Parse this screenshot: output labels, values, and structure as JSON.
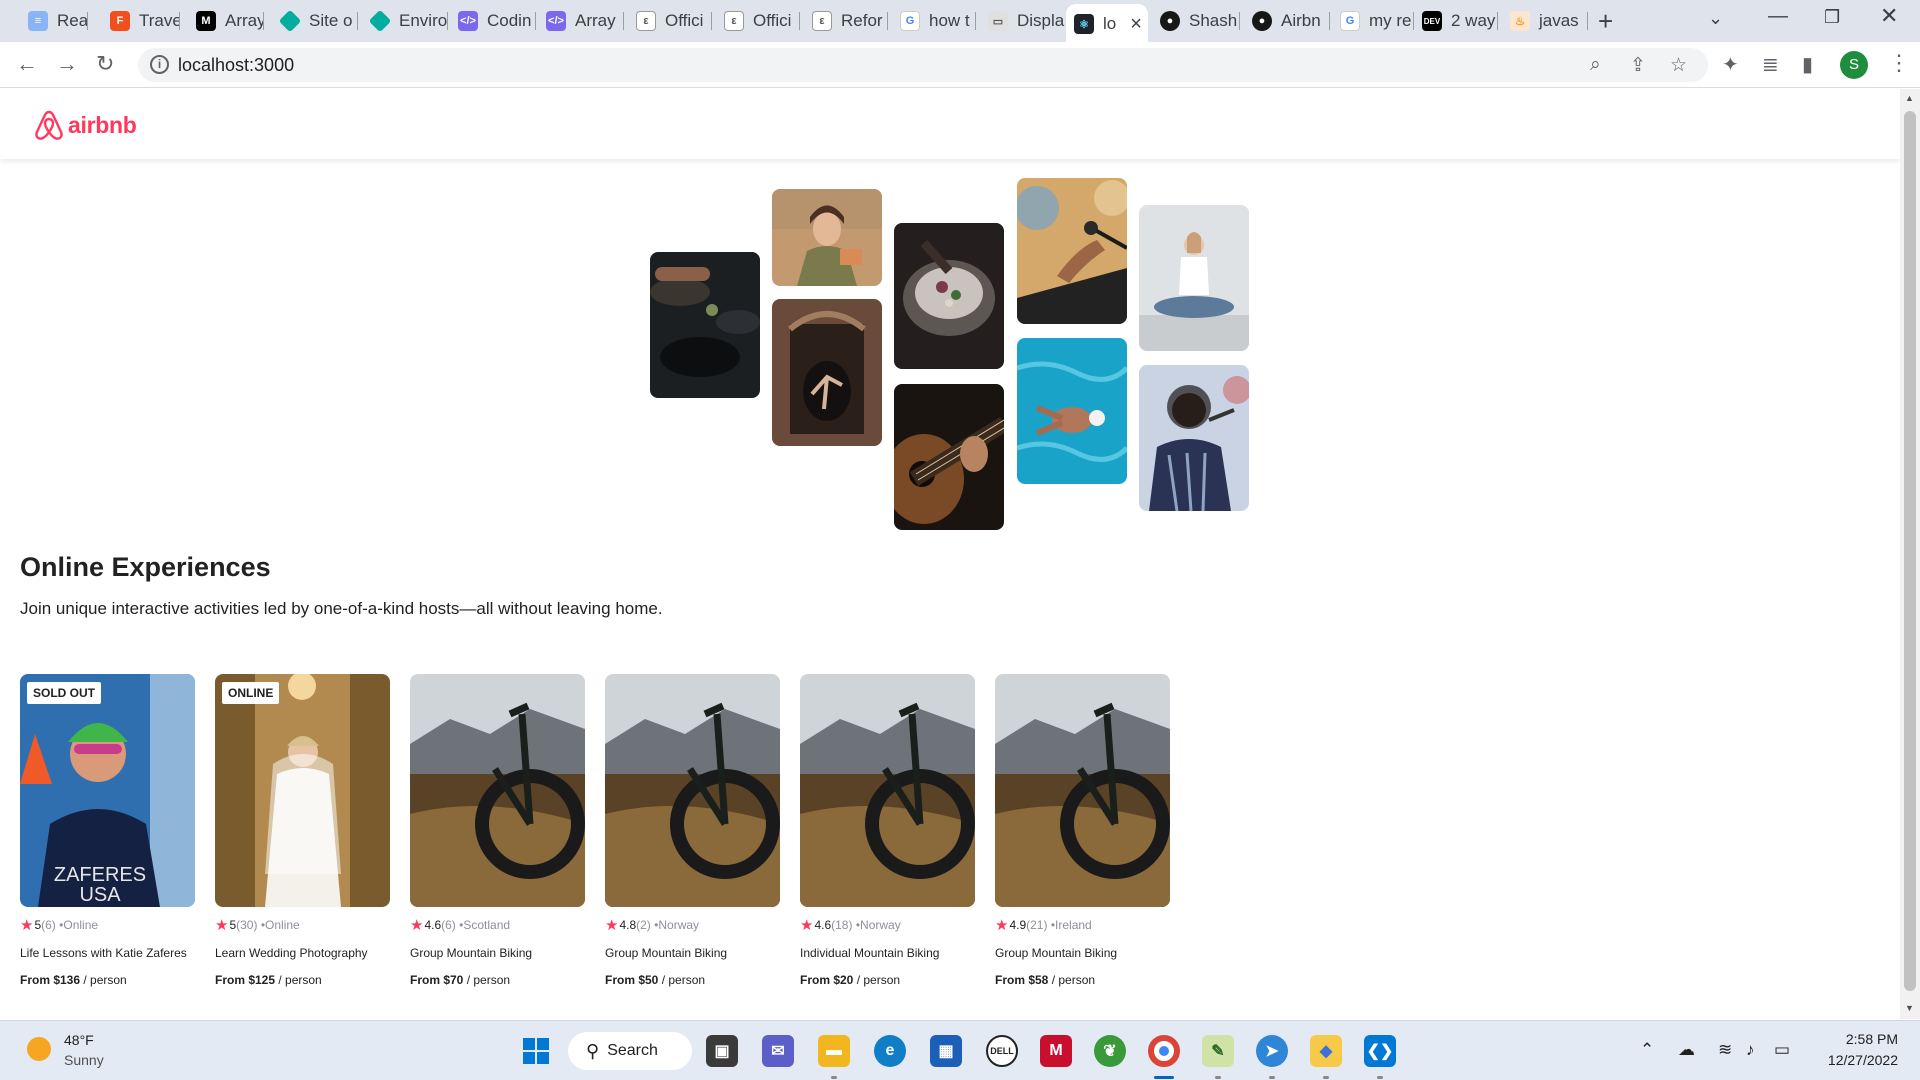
{
  "browser": {
    "tabs": [
      {
        "label": "React",
        "icon": "react-doc-icon",
        "color": "#8ab4f8"
      },
      {
        "label": "Travel",
        "icon": "figma-icon",
        "color": "#f24e1e"
      },
      {
        "label": "Array",
        "icon": "medium-icon",
        "color": "#000000"
      },
      {
        "label": "Site o",
        "icon": "netlify-icon",
        "color": "#00ad9f"
      },
      {
        "label": "Enviro",
        "icon": "netlify-icon",
        "color": "#00ad9f"
      },
      {
        "label": "Codin",
        "icon": "code-icon",
        "color": "#7b68ee"
      },
      {
        "label": "Array",
        "icon": "code-icon",
        "color": "#7b68ee"
      },
      {
        "label": "Offici",
        "icon": "scrimba-icon",
        "color": "#555555"
      },
      {
        "label": "Offici",
        "icon": "scrimba-icon",
        "color": "#555555"
      },
      {
        "label": "Refor",
        "icon": "scrimba-icon",
        "color": "#555555"
      },
      {
        "label": "how t",
        "icon": "google-icon",
        "color": "#4285f4"
      },
      {
        "label": "Displa",
        "icon": "display-icon",
        "color": "#777777"
      },
      {
        "label": "lo",
        "icon": "react-icon",
        "color": "#20232a"
      },
      {
        "label": "Shash",
        "icon": "github-icon",
        "color": "#181717"
      },
      {
        "label": "Airbn",
        "icon": "github-icon",
        "color": "#181717"
      },
      {
        "label": "my re",
        "icon": "google-icon",
        "color": "#4285f4"
      },
      {
        "label": "2 way",
        "icon": "dev-icon",
        "color": "#000000"
      },
      {
        "label": "javas",
        "icon": "java-icon",
        "color": "#f89820"
      }
    ],
    "url": "localhost:3000",
    "profile_initial": "S"
  },
  "page": {
    "brand": "airbnb",
    "brand_color": "#ff385c",
    "hero": {
      "title": "Online Experiences",
      "subtitle": "Join unique interactive activities led by one-of-a-kind hosts—all without leaving home."
    },
    "cards": [
      {
        "badge": "SOLD OUT",
        "rating": "5",
        "reviews": "(6)",
        "location": "Online",
        "title": "Life Lessons with Katie Zaferes",
        "price": "From $136",
        "unit": "/ person",
        "jersey_1": "ZAFERES",
        "jersey_2": "USA"
      },
      {
        "badge": "ONLINE",
        "rating": "5",
        "reviews": "(30)",
        "location": "Online",
        "title": "Learn Wedding Photography",
        "price": "From $125",
        "unit": "/ person"
      },
      {
        "badge": "",
        "rating": "4.6",
        "reviews": "(6)",
        "location": "Scotland",
        "title": "Group Mountain Biking",
        "price": "From $70",
        "unit": "/ person"
      },
      {
        "badge": "",
        "rating": "4.8",
        "reviews": "(2)",
        "location": "Norway",
        "title": "Group Mountain Biking",
        "price": "From $50",
        "unit": "/ person"
      },
      {
        "badge": "",
        "rating": "4.6",
        "reviews": "(18)",
        "location": "Norway",
        "title": "Individual Mountain Biking",
        "price": "From $20",
        "unit": "/ person"
      },
      {
        "badge": "",
        "rating": "4.9",
        "reviews": "(21)",
        "location": "Ireland",
        "title": "Group Mountain Biking",
        "price": "From $58",
        "unit": "/ person"
      }
    ]
  },
  "taskbar": {
    "weather_temp": "48°F",
    "weather_cond": "Sunny",
    "search_label": "Search",
    "time": "2:58 PM",
    "date": "12/27/2022"
  }
}
